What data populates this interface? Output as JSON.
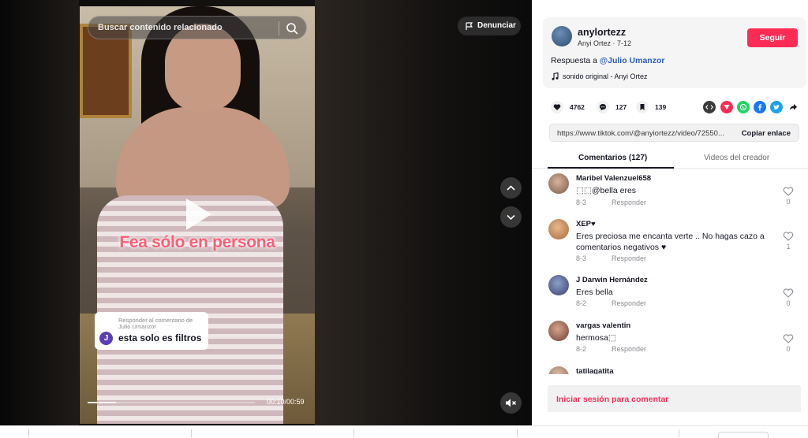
{
  "video": {
    "search_placeholder": "Buscar contenido relacionado",
    "report_label": "Denunciar",
    "caption": "Fea sólo en persona",
    "reply_card": {
      "heading": "Responder al comentario de Julio Umanzor",
      "avatar_initial": "J",
      "text": "esta solo es filtros"
    },
    "time": "00:10/00:59",
    "progress_fraction": 0.17
  },
  "author": {
    "username": "anylortezz",
    "display_and_date": "Anyi Ortez · 7-12",
    "follow_label": "Seguir",
    "desc_prefix": "Respuesta a ",
    "desc_mention": "@Julio Umanzor",
    "sound": "sonido original - Anyi Ortez"
  },
  "stats": {
    "likes": "4762",
    "comments": "127",
    "saves": "139"
  },
  "share_icons": [
    "embed-icon",
    "repost-icon",
    "whatsapp-icon",
    "facebook-icon",
    "twitter-icon",
    "share-arrow-icon"
  ],
  "link": {
    "url": "https://www.tiktok.com/@anyiortezz/video/72550...",
    "copy_label": "Copiar enlace"
  },
  "tabs": {
    "comments": "Comentarios (127)",
    "videos": "Videos del creador"
  },
  "comments": [
    {
      "name": "Maribel Valenzuel658",
      "text": "⬚⬚@bella eres",
      "date": "8-3",
      "reply": "Responder",
      "likes": "0"
    },
    {
      "name": "XEP♥",
      "text": "Eres preciosa me encanta verte .. No hagas cazo a comentarios negativos ♥",
      "date": "8-3",
      "reply": "Responder",
      "likes": "1"
    },
    {
      "name": "J Darwin Hernández",
      "text": "Eres bella",
      "date": "8-2",
      "reply": "Responder",
      "likes": "0"
    },
    {
      "name": "vargas valentin",
      "text": "hermosa⬚",
      "date": "8-2",
      "reply": "Responder",
      "likes": "0"
    },
    {
      "name": "tatilagatita",
      "text": "",
      "date": "",
      "reply": "",
      "likes": ""
    }
  ],
  "login_label": "Iniciar sesión para comentar",
  "colors": {
    "brand": "#fe2c55",
    "mention": "#2b5db9",
    "caption": "#ff5d75"
  }
}
